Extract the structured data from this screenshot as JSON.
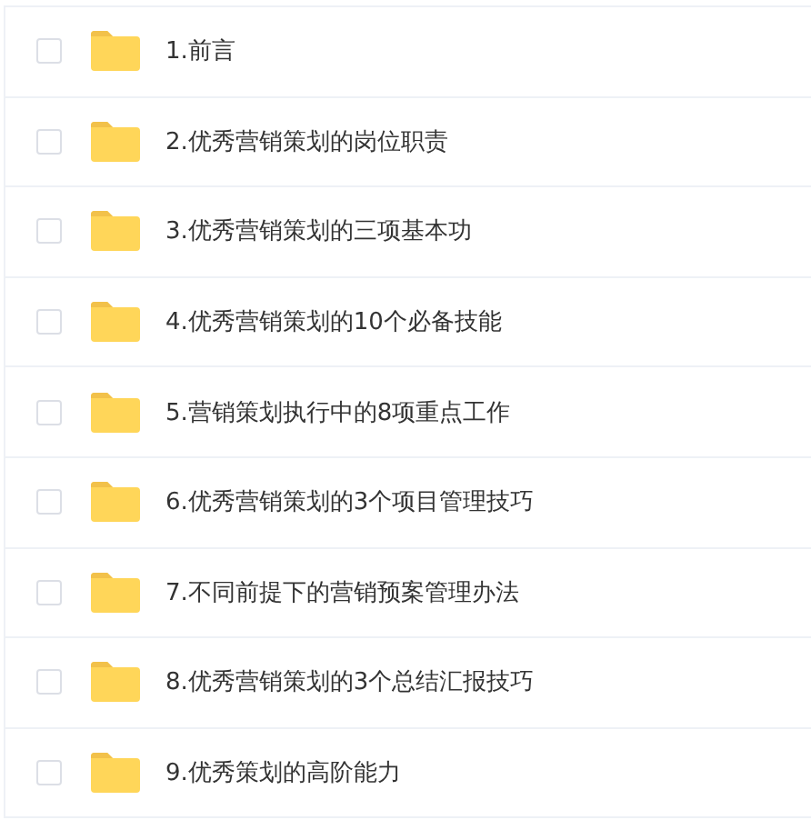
{
  "items": [
    {
      "name": "1.前言",
      "checked": false
    },
    {
      "name": "2.优秀营销策划的岗位职责",
      "checked": false
    },
    {
      "name": "3.优秀营销策划的三项基本功",
      "checked": false
    },
    {
      "name": "4.优秀营销策划的10个必备技能",
      "checked": false
    },
    {
      "name": "5.营销策划执行中的8项重点工作",
      "checked": false
    },
    {
      "name": "6.优秀营销策划的3个项目管理技巧",
      "checked": false
    },
    {
      "name": "7.不同前提下的营销预案管理办法",
      "checked": false
    },
    {
      "name": "8.优秀营销策划的3个总结汇报技巧",
      "checked": false
    },
    {
      "name": "9.优秀策划的高阶能力",
      "checked": false
    }
  ]
}
